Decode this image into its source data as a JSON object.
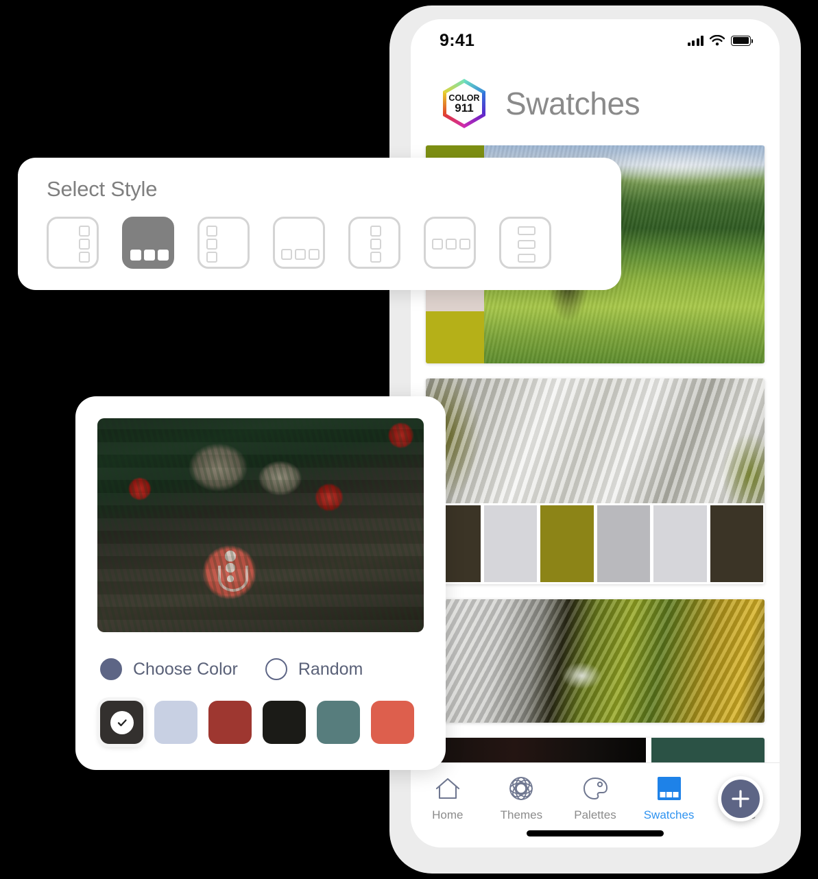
{
  "phone": {
    "status_bar": {
      "time": "9:41",
      "signal_icon": "cellular-signal-icon",
      "wifi_icon": "wifi-icon",
      "battery_icon": "battery-full-icon"
    },
    "header": {
      "logo_icon": "color911-hexagon-logo",
      "logo_text_top": "COLOR",
      "logo_text_bottom": "911",
      "title": "Swatches"
    },
    "fab": {
      "icon": "plus-icon",
      "color": "#5d6585"
    },
    "tab_bar": {
      "active_color": "#2f93f0",
      "inactive_color": "#8b8b8b",
      "items": [
        {
          "label": "Home",
          "icon": "home-icon",
          "active": false
        },
        {
          "label": "Themes",
          "icon": "themes-circles-icon",
          "active": false
        },
        {
          "label": "Palettes",
          "icon": "palette-icon",
          "active": false
        },
        {
          "label": "Swatches",
          "icon": "swatches-grid-icon",
          "active": true
        },
        {
          "label": "More",
          "icon": "hamburger-menu-icon",
          "active": false
        }
      ]
    },
    "swatch_cards": [
      {
        "name": "green-hills-swatch",
        "photo": "green rolling hills with tree and pond",
        "layout": "left-rail",
        "colors": [
          "#7d8f13",
          "#3d4a15",
          "#ded2cd",
          "#b5b018"
        ]
      },
      {
        "name": "waterfall-swatch",
        "photo": "long-exposure waterfall over mossy rocks",
        "layout": "bottom-strip",
        "colors": [
          "#3b3426",
          "#d6d6da",
          "#8c8417",
          "#b9b9bd",
          "#d6d6da",
          "#3b3426"
        ]
      },
      {
        "name": "mossy-waterfall-swatch",
        "photo": "waterfall beside bright green and gold moss",
        "layout": "photo-only",
        "colors": []
      },
      {
        "name": "purple-flowers-swatch",
        "photo": "purple orchid flowers on dark background",
        "layout": "split",
        "colors": [
          "#2b5245"
        ]
      }
    ]
  },
  "style_panel": {
    "title": "Select Style",
    "selected_index": 1,
    "options": [
      {
        "name": "style-squares-right",
        "squares": "vertical",
        "position": "right",
        "selected": false
      },
      {
        "name": "style-squares-bottom-filled",
        "squares": "horizontal",
        "position": "bottom",
        "selected": true
      },
      {
        "name": "style-squares-left",
        "squares": "vertical",
        "position": "left",
        "selected": false
      },
      {
        "name": "style-squares-bottom-left",
        "squares": "horizontal",
        "position": "bottom-left",
        "selected": false
      },
      {
        "name": "style-squares-center-vert",
        "squares": "vertical",
        "position": "center",
        "selected": false
      },
      {
        "name": "style-squares-center-horiz",
        "squares": "horizontal",
        "position": "center",
        "selected": false
      },
      {
        "name": "style-bars-center-vert",
        "squares": "vertical-wide",
        "position": "center",
        "selected": false
      }
    ]
  },
  "picker_card": {
    "photo": {
      "name": "christmas-latte-photo",
      "description": "red latte with heart art, pine cones, apples and evergreen branches on dark wood"
    },
    "mode_options": [
      {
        "label": "Choose Color",
        "name": "choose-color-radio",
        "selected": true
      },
      {
        "label": "Random",
        "name": "random-radio",
        "selected": false
      }
    ],
    "accent_color": "#5d6585",
    "palette": [
      {
        "name": "swatch-selected-dark",
        "hex": "#33302e",
        "selected": true
      },
      {
        "name": "swatch-light-periwinkle",
        "hex": "#c8d0e3",
        "selected": false
      },
      {
        "name": "swatch-brick-red",
        "hex": "#9e3730",
        "selected": false
      },
      {
        "name": "swatch-near-black",
        "hex": "#1b1b17",
        "selected": false
      },
      {
        "name": "swatch-teal",
        "hex": "#577d7d",
        "selected": false
      },
      {
        "name": "swatch-coral",
        "hex": "#dd5f4d",
        "selected": false
      }
    ],
    "check_icon": "check-icon"
  }
}
